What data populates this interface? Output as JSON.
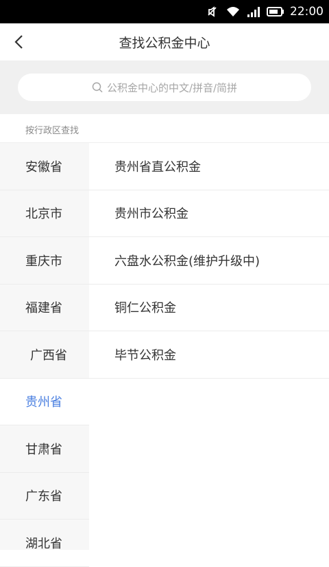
{
  "status_bar": {
    "time": "22:00"
  },
  "header": {
    "title": "查找公积金中心"
  },
  "search": {
    "placeholder": "公积金中心的中文/拼音/简拼"
  },
  "section": {
    "label": "按行政区查找"
  },
  "provinces": [
    {
      "name": "安徽省",
      "active": false
    },
    {
      "name": "北京市",
      "active": false
    },
    {
      "name": "重庆市",
      "active": false
    },
    {
      "name": "福建省",
      "active": false
    },
    {
      "name": "广西省",
      "active": false
    },
    {
      "name": "贵州省",
      "active": true
    },
    {
      "name": "甘肃省",
      "active": false
    },
    {
      "name": "广东省",
      "active": false
    },
    {
      "name": "湖北省",
      "active": false
    }
  ],
  "funds": [
    {
      "name": "贵州省直公积金"
    },
    {
      "name": "贵州市公积金"
    },
    {
      "name": "六盘水公积金(维护升级中)"
    },
    {
      "name": "铜仁公积金"
    },
    {
      "name": "毕节公积金"
    }
  ],
  "colors": {
    "accent": "#4a7fe0",
    "background": "#f0f0f0"
  }
}
